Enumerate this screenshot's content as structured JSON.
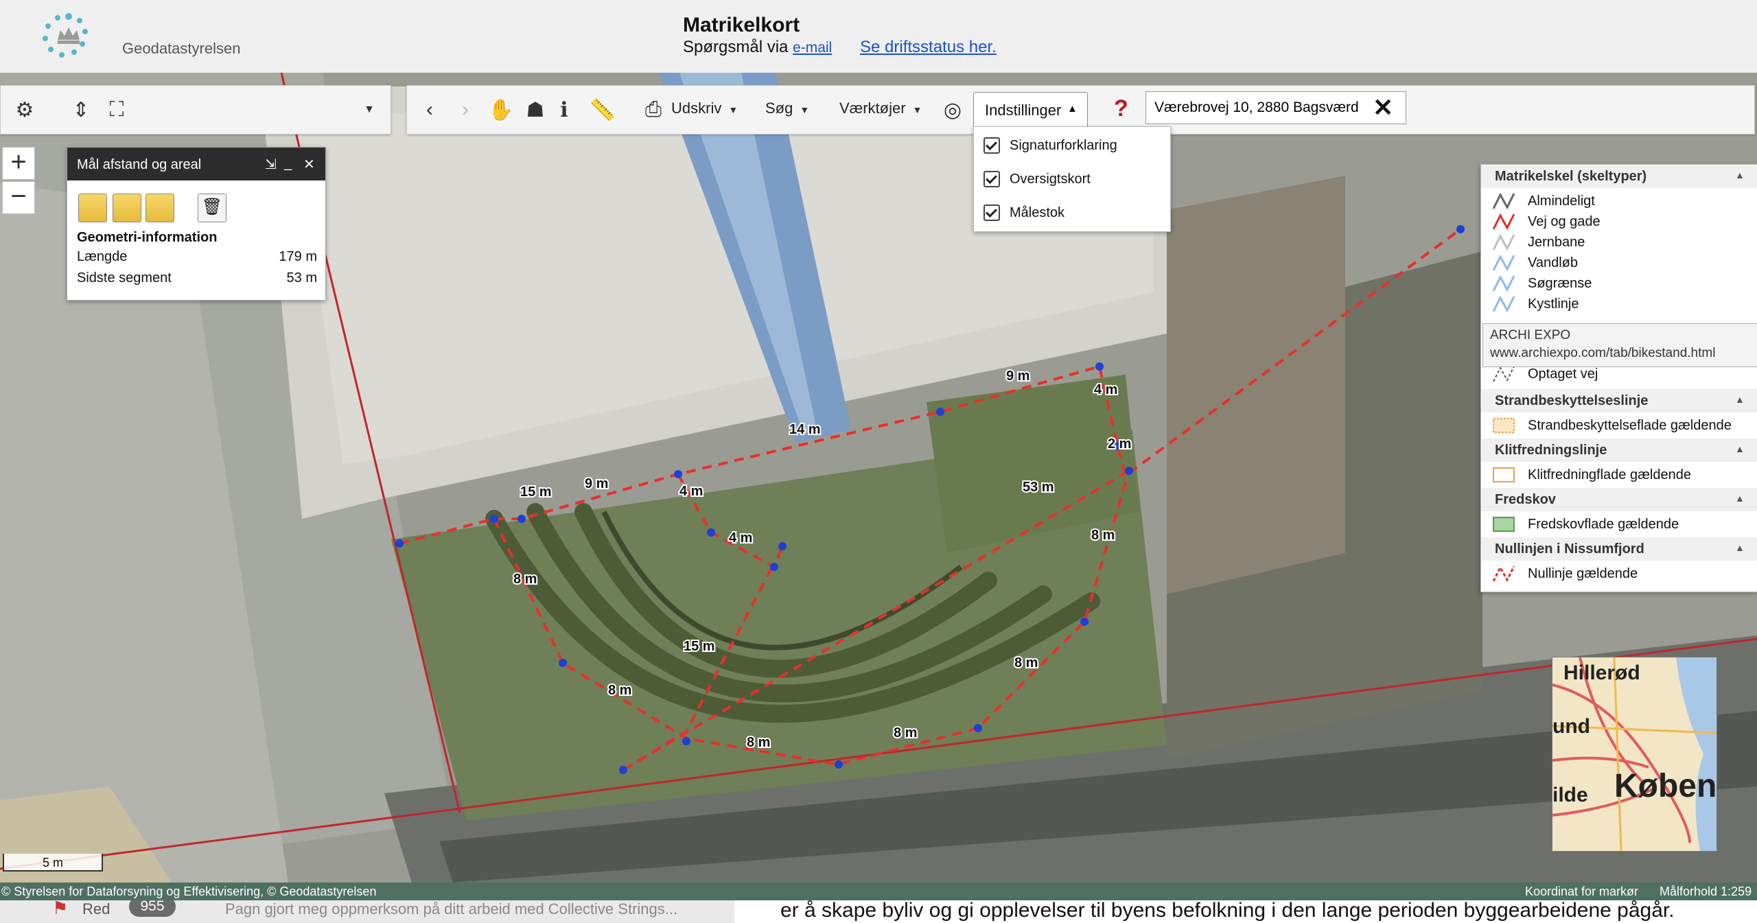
{
  "header": {
    "logo_text": "Geodatastyrelsen",
    "title": "Matrikelkort",
    "subtitle_prefix": "Spørgsmål via",
    "email_link": "e-mail",
    "status_link": "Se driftsstatus her."
  },
  "toolbar": {
    "menus": {
      "print": "Udskriv",
      "search": "Søg",
      "tools": "Værktøjer",
      "settings": "Indstillinger"
    },
    "search_value": "Værebrovej 10, 2880 Bagsværd"
  },
  "settings_dropdown": {
    "items": [
      {
        "label": "Signaturforklaring",
        "checked": true
      },
      {
        "label": "Oversigtskort",
        "checked": true
      },
      {
        "label": "Målestok",
        "checked": true
      }
    ]
  },
  "measure_panel": {
    "title": "Mål afstand og areal",
    "section": "Geometri-information",
    "rows": [
      {
        "label": "Længde",
        "value": "179 m"
      },
      {
        "label": "Sidste segment",
        "value": "53 m"
      }
    ]
  },
  "map": {
    "measurement_labels": [
      "9 m",
      "4 m",
      "14 m",
      "2 m",
      "15 m",
      "9 m",
      "4 m",
      "53 m",
      "4 m",
      "8 m",
      "8 m",
      "15 m",
      "8 m",
      "8 m",
      "8 m",
      "8 m"
    ],
    "colors": {
      "measure_line": "#e8302a",
      "vertex": "#1f3fd6",
      "parcel_line": "#c0262b"
    }
  },
  "legend": {
    "sections": [
      {
        "title": "Matrikelskel (skeltyper)",
        "items": [
          {
            "label": "Almindeligt",
            "color": "#666666"
          },
          {
            "label": "Vej og gade",
            "color": "#e0302a"
          },
          {
            "label": "Jernbane",
            "color": "#bdbdbd"
          },
          {
            "label": "Vandløb",
            "color": "#8fb8ee"
          },
          {
            "label": "Søgrænse",
            "color": "#8fb8ee"
          },
          {
            "label": "Kystlinje",
            "color": "#8fb8ee"
          }
        ]
      }
    ],
    "tooltip": {
      "title": "ARCHI EXPO",
      "url": "www.archiexpo.com/tab/bikestand.html"
    },
    "extra_item": "Optaget vej",
    "sections2": [
      {
        "title": "Strandbeskyttelseslinje",
        "item": "Strandbeskyttelseflade gældende"
      },
      {
        "title": "Klitfredningslinje",
        "item": "Klitfredningflade gældende"
      },
      {
        "title": "Fredskov",
        "item": "Fredskovflade gældende"
      },
      {
        "title": "Nullinjen i Nissumfjord",
        "item": "Nullinje gældende"
      }
    ]
  },
  "overview_map": {
    "labels": [
      "Hillerød",
      "und",
      "ilde",
      "Køben"
    ]
  },
  "scale_bar": "5 m",
  "footer": {
    "copyright": "© Styrelsen for Dataforsyning og Effektivisering, © Geodatastyrelsen",
    "coordinate": "Koordinat for markør",
    "scale": "Målforhold 1:259"
  },
  "underlay": {
    "red": "Red",
    "badge": "955",
    "text_left": "Pagn gjort meg oppmerksom på ditt arbeid med Collective Strings...",
    "text_right": "er å skape byliv og gi opplevelser til byens befolkning i den lange perioden byggearbeidene pågår."
  }
}
